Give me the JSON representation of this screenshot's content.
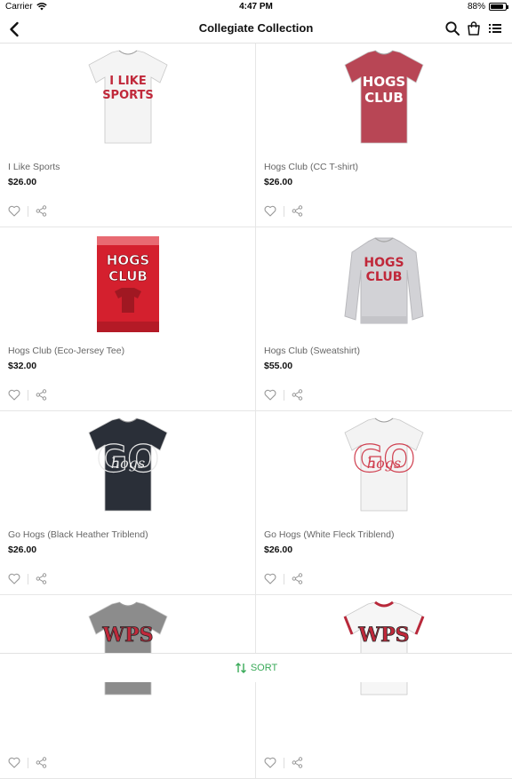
{
  "status": {
    "carrier": "Carrier",
    "time": "4:47 PM",
    "battery": "88%",
    "battery_level": 0.88
  },
  "nav": {
    "title": "Collegiate Collection"
  },
  "products": [
    {
      "name": "I Like Sports",
      "price": "$26.00",
      "shirt_color": "#f4f4f4",
      "text": "I LIKE SPORTS",
      "text_color": "#c0283a"
    },
    {
      "name": "Hogs Club (CC T-shirt)",
      "price": "$26.00",
      "shirt_color": "#b84655",
      "text": "HOGS CLUB",
      "text_color": "#ffffff"
    },
    {
      "name": "Hogs Club (Eco-Jersey Tee)",
      "price": "$32.00",
      "shirt_color": "#d4202e",
      "text": "HOGS CLUB",
      "text_color": "#ffffff"
    },
    {
      "name": "Hogs Club (Sweatshirt)",
      "price": "$55.00",
      "shirt_color": "#d2d2d6",
      "text": "HOGS CLUB",
      "text_color": "#c0283a"
    },
    {
      "name": "Go Hogs (Black Heather Triblend)",
      "price": "$26.00",
      "shirt_color": "#2a2f38",
      "text": "GO hogs",
      "text_color": "#e8e8e8"
    },
    {
      "name": "Go Hogs (White Fleck Triblend)",
      "price": "$26.00",
      "shirt_color": "#f3f3f3",
      "text": "GO hogs",
      "text_color": "#d04050"
    },
    {
      "name": "",
      "price": "",
      "shirt_color": "#8c8c8c",
      "text": "WPS",
      "text_color": "#c0283a"
    },
    {
      "name": "",
      "price": "",
      "shirt_color": "#f6f6f6",
      "text": "WPS",
      "text_color": "#c0283a"
    }
  ],
  "sort": {
    "label": "SORT"
  },
  "colors": {
    "accent": "#3aaa59"
  },
  "icons": [
    "back-chevron-icon",
    "search-icon",
    "shopping-bag-icon",
    "list-view-icon",
    "heart-icon",
    "share-icon",
    "sort-arrows-icon"
  ]
}
